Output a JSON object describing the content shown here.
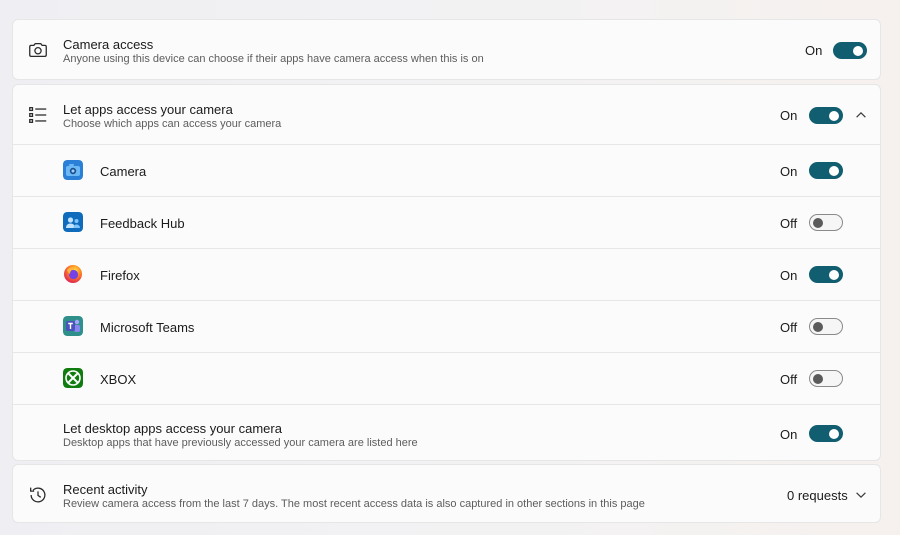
{
  "camera_access": {
    "title": "Camera access",
    "subtitle": "Anyone using this device can choose if their apps have camera access when this is on",
    "state": "On"
  },
  "let_apps": {
    "title": "Let apps access your camera",
    "subtitle": "Choose which apps can access your camera",
    "state": "On",
    "apps": [
      {
        "name": "Camera",
        "state": "On"
      },
      {
        "name": "Feedback Hub",
        "state": "Off"
      },
      {
        "name": "Firefox",
        "state": "On"
      },
      {
        "name": "Microsoft Teams",
        "state": "Off"
      },
      {
        "name": "XBOX",
        "state": "Off"
      }
    ]
  },
  "desktop_apps": {
    "title": "Let desktop apps access your camera",
    "subtitle": "Desktop apps that have previously accessed your camera are listed here",
    "state": "On"
  },
  "recent_activity": {
    "title": "Recent activity",
    "subtitle": "Review camera access from the last 7 days. The most recent access data is also captured in other sections in this page",
    "count": "0 requests"
  },
  "colors": {
    "accent": "#115e70",
    "toggle_off_border": "#8a8a8a"
  },
  "icons": {
    "camera_access": "camera-outline-icon",
    "let_apps": "list-icon",
    "recent_activity": "history-icon",
    "collapse": "chevron-up-icon",
    "expand": "chevron-down-icon"
  }
}
